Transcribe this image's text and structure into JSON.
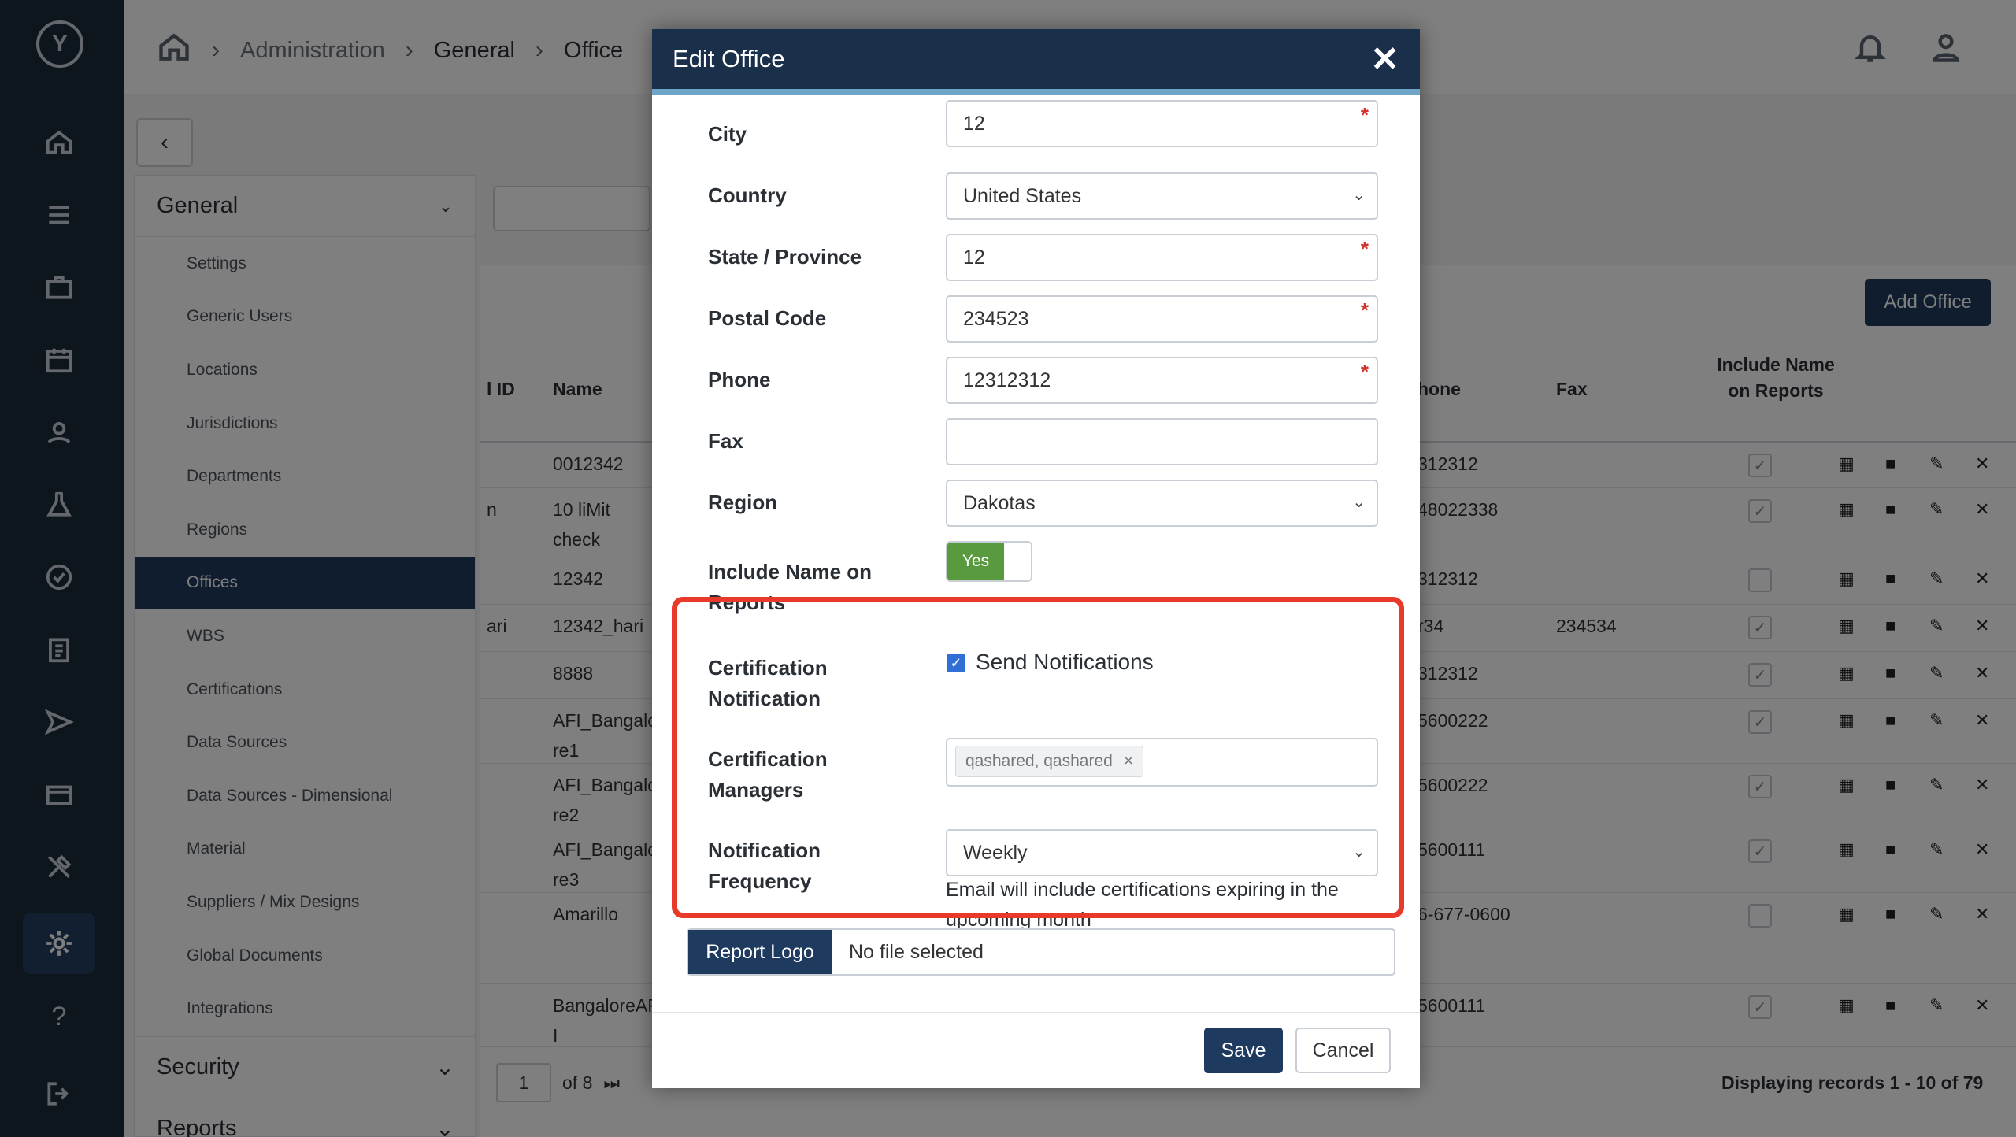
{
  "breadcrumb": [
    "Administration",
    "General",
    "Office"
  ],
  "side_menu": {
    "section": "General",
    "items": [
      "Settings",
      "Generic Users",
      "Locations",
      "Jurisdictions",
      "Departments",
      "Regions",
      "Offices",
      "WBS",
      "Certifications",
      "Data Sources",
      "Data Sources - Dimensional",
      "Material",
      "Suppliers / Mix Designs",
      "Global Documents",
      "Integrations"
    ],
    "active": "Offices",
    "other_sections": [
      "Security",
      "Reports"
    ]
  },
  "table": {
    "add_button": "Add Office",
    "headers": {
      "id": "l ID",
      "name": "Name",
      "phone": "hone",
      "fax": "Fax",
      "include": "Include Name on Reports"
    },
    "rows": [
      {
        "id": "",
        "name": "0012342",
        "phone": "312312",
        "fax": "",
        "checked": true
      },
      {
        "id": "n",
        "name": "10 liMit check",
        "phone": "48022338",
        "fax": "",
        "checked": true
      },
      {
        "id": "",
        "name": "12342",
        "phone": "312312",
        "fax": "",
        "checked": false
      },
      {
        "id": "ari",
        "name": "12342_hari",
        "phone": "r34",
        "fax": "234534",
        "checked": true
      },
      {
        "id": "",
        "name": "8888",
        "phone": "312312",
        "fax": "",
        "checked": true
      },
      {
        "id": "",
        "name": "AFI_Bangalo re1",
        "phone": "5600222",
        "fax": "",
        "checked": true
      },
      {
        "id": "",
        "name": "AFI_Bangalo re2",
        "phone": "5600222",
        "fax": "",
        "checked": true
      },
      {
        "id": "",
        "name": "AFI_Bangalo re3",
        "phone": "5600111",
        "fax": "",
        "checked": true
      },
      {
        "id": "",
        "name": "Amarillo",
        "phone": "6-677-0600",
        "fax": "",
        "checked": false
      },
      {
        "id": "",
        "name": "BangaloreAF I",
        "phone": "5600111",
        "fax": "",
        "checked": true
      }
    ],
    "pager": {
      "page": "1",
      "of": "of 8"
    },
    "records": "Displaying records  1 - 10  of  79"
  },
  "modal": {
    "title": "Edit Office",
    "fields": {
      "city": {
        "label": "City",
        "value": "12"
      },
      "country": {
        "label": "Country",
        "value": "United States"
      },
      "state": {
        "label": "State / Province",
        "value": "12"
      },
      "postal": {
        "label": "Postal Code",
        "value": "234523"
      },
      "phone": {
        "label": "Phone",
        "value": "12312312"
      },
      "fax": {
        "label": "Fax",
        "value": ""
      },
      "region": {
        "label": "Region",
        "value": "Dakotas"
      },
      "include_name": {
        "label": "Include Name on Reports",
        "value": "Yes"
      },
      "cert_notification": {
        "label": "Certification Notification",
        "checkbox_label": "Send Notifications",
        "checked": true
      },
      "cert_managers": {
        "label": "Certification Managers",
        "tag": "qashared, qashared"
      },
      "notification_frequency": {
        "label": "Notification Frequency",
        "value": "Weekly",
        "help": "Email will include certifications expiring in the upcoming month"
      }
    },
    "report_logo": {
      "button": "Report Logo",
      "text": "No file selected"
    },
    "save": "Save",
    "cancel": "Cancel"
  },
  "colors": {
    "navy": "#1e3a5f",
    "highlight": "#e83a2a",
    "toggle_on": "#5a9a3e"
  }
}
